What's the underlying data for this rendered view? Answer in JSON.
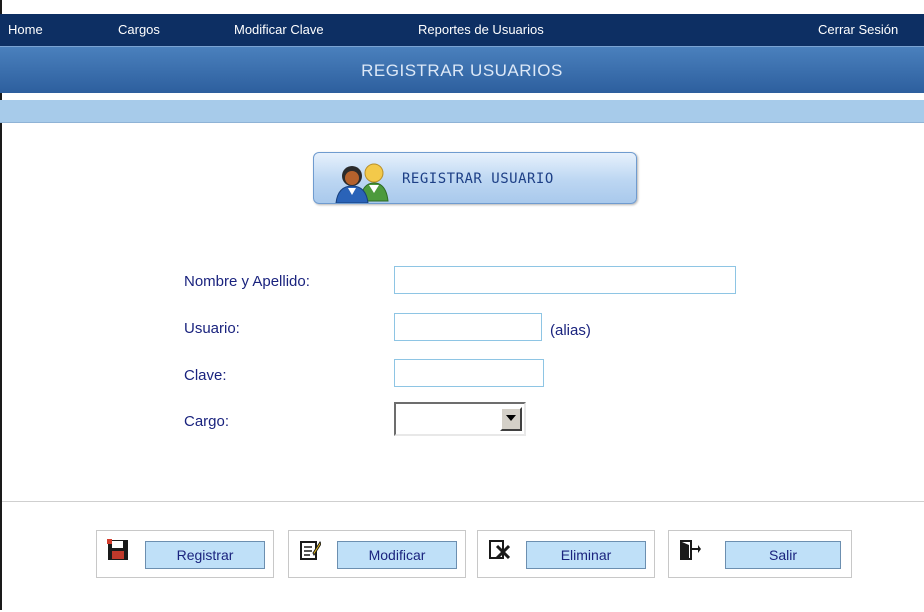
{
  "nav": {
    "home": "Home",
    "cargos": "Cargos",
    "modificar_clave": "Modificar Clave",
    "reportes": "Reportes de Usuarios",
    "cerrar": "Cerrar Sesión"
  },
  "page": {
    "title": "REGISTRAR USUARIOS",
    "badge": "REGISTRAR USUARIO"
  },
  "form": {
    "nombre_label": "Nombre y Apellido:",
    "nombre_value": "",
    "usuario_label": "Usuario:",
    "usuario_value": "",
    "usuario_hint": "(alias)",
    "clave_label": "Clave:",
    "clave_value": "",
    "cargo_label": "Cargo:",
    "cargo_value": ""
  },
  "actions": {
    "registrar": "Registrar",
    "modificar": "Modificar",
    "eliminar": "Eliminar",
    "salir": "Salir"
  },
  "icons": {
    "badge": "users-icon",
    "registrar": "floppy-disk-icon",
    "modificar": "edit-note-icon",
    "eliminar": "delete-document-icon",
    "salir": "exit-door-icon"
  },
  "colors": {
    "nav_bg": "#0d2f63",
    "title_bar": "#3c6ead",
    "sub_bar": "#a7cbea",
    "label_text": "#1a237e",
    "button_bg": "#bfe0f8"
  }
}
